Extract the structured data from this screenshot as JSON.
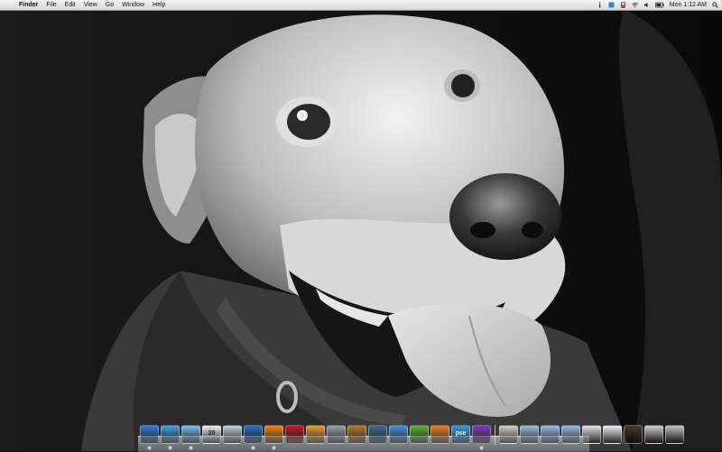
{
  "menubar": {
    "apple_glyph": "",
    "app_name": "Finder",
    "menus": [
      "File",
      "Edit",
      "View",
      "Go",
      "Window",
      "Help"
    ],
    "clock": "Mon 1:12 AM"
  },
  "status_icons": [
    "info-icon",
    "dropbox-icon",
    "battery-monitor-icon",
    "wifi-icon",
    "volume-icon",
    "battery-icon",
    "spotlight-icon"
  ],
  "dock": {
    "items": [
      {
        "name": "finder-icon",
        "color": "#3a7bd5"
      },
      {
        "name": "safari-icon",
        "color": "#4aa3df"
      },
      {
        "name": "ichat-icon",
        "color": "#7cc0f0"
      },
      {
        "name": "ical-icon",
        "color": "#f2f2f2",
        "text": "20"
      },
      {
        "name": "preview-icon",
        "color": "#c8d4e0"
      },
      {
        "name": "itunes-icon",
        "color": "#2f6fc2"
      },
      {
        "name": "vlc-icon",
        "color": "#f08a1c"
      },
      {
        "name": "photo-booth-icon",
        "color": "#b8202a"
      },
      {
        "name": "iphoto-icon",
        "color": "#e4a23c"
      },
      {
        "name": "script-editor-icon",
        "color": "#9aa0a8"
      },
      {
        "name": "garageband-icon",
        "color": "#b57a2c"
      },
      {
        "name": "photoshop-icon",
        "color": "#3c6f8f"
      },
      {
        "name": "web-app-icon",
        "color": "#4d8fd6"
      },
      {
        "name": "green-app-icon",
        "color": "#5fae3a"
      },
      {
        "name": "orange-app-icon",
        "color": "#e5812a"
      },
      {
        "name": "pse-icon",
        "color": "#3a9ad9",
        "text": "pse"
      },
      {
        "name": "frame-app-icon",
        "color": "#7c3fb0"
      },
      {
        "name": "divider"
      },
      {
        "name": "home-folder-icon",
        "color": "#d8d0c0"
      },
      {
        "name": "applications-folder-icon",
        "color": "#9bbbe0"
      },
      {
        "name": "documents-folder-icon",
        "color": "#9bbbe0"
      },
      {
        "name": "downloads-folder-icon",
        "color": "#9bbbe0"
      },
      {
        "name": "stack-icon",
        "color": "#dfe6ee"
      },
      {
        "name": "document-stack-icon",
        "color": "#eef1f4"
      },
      {
        "name": "photo-stack-icon",
        "color": "#4a3a30"
      },
      {
        "name": "pencil-stack-icon",
        "color": "#cfcfcf"
      },
      {
        "name": "trash-icon",
        "color": "#bcc4cc"
      }
    ]
  }
}
